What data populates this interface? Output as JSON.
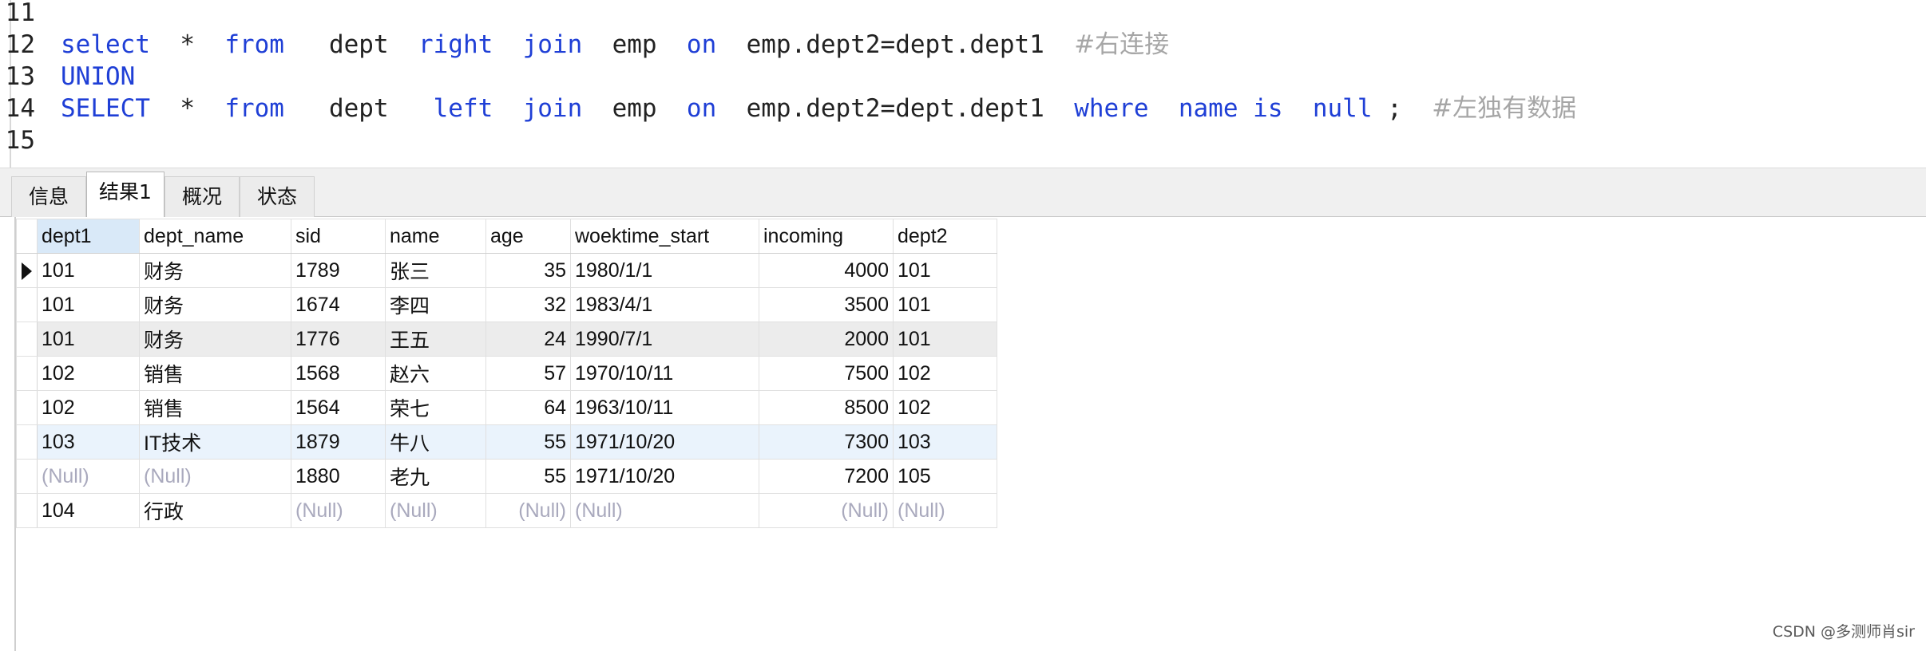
{
  "editor": {
    "lines": [
      {
        "num": "11",
        "tokens": []
      },
      {
        "num": "12",
        "tokens": [
          {
            "t": "select",
            "c": "kw",
            "gap": "  "
          },
          {
            "t": "*",
            "c": "tx",
            "gap": "  "
          },
          {
            "t": "from",
            "c": "kw",
            "gap": "   "
          },
          {
            "t": "dept",
            "c": "tx",
            "gap": "  "
          },
          {
            "t": "right",
            "c": "kw",
            "gap": "  "
          },
          {
            "t": "join",
            "c": "kw",
            "gap": "  "
          },
          {
            "t": "emp",
            "c": "tx",
            "gap": "  "
          },
          {
            "t": "on",
            "c": "kw",
            "gap": "  "
          },
          {
            "t": "emp.dept2=dept.dept1",
            "c": "tx",
            "gap": "  "
          },
          {
            "t": "#右连接",
            "c": "cm",
            "gap": ""
          }
        ]
      },
      {
        "num": "13",
        "tokens": [
          {
            "t": "UNION",
            "c": "kw",
            "gap": ""
          }
        ]
      },
      {
        "num": "14",
        "tokens": [
          {
            "t": "SELECT",
            "c": "kw",
            "gap": "  "
          },
          {
            "t": "*",
            "c": "tx",
            "gap": "  "
          },
          {
            "t": "from",
            "c": "kw",
            "gap": "   "
          },
          {
            "t": "dept",
            "c": "tx",
            "gap": "   "
          },
          {
            "t": "left",
            "c": "kw",
            "gap": "  "
          },
          {
            "t": "join",
            "c": "kw",
            "gap": "  "
          },
          {
            "t": "emp",
            "c": "tx",
            "gap": "  "
          },
          {
            "t": "on",
            "c": "kw",
            "gap": "  "
          },
          {
            "t": "emp.dept2=dept.dept1",
            "c": "tx",
            "gap": "  "
          },
          {
            "t": "where",
            "c": "kw",
            "gap": "  "
          },
          {
            "t": "name",
            "c": "kw",
            "gap": " "
          },
          {
            "t": "is",
            "c": "kw",
            "gap": "  "
          },
          {
            "t": "null",
            "c": "kw",
            "gap": " "
          },
          {
            "t": ";",
            "c": "tx",
            "gap": "  "
          },
          {
            "t": "#左独有数据",
            "c": "cm",
            "gap": ""
          }
        ]
      },
      {
        "num": "15",
        "tokens": []
      }
    ]
  },
  "tabs": [
    {
      "label": "信息",
      "active": false
    },
    {
      "label": "结果1",
      "active": true
    },
    {
      "label": "概况",
      "active": false
    },
    {
      "label": "状态",
      "active": false
    }
  ],
  "result": {
    "columns": [
      "dept1",
      "dept_name",
      "sid",
      "name",
      "age",
      "woektime_start",
      "incoming",
      "dept2"
    ],
    "rows": [
      [
        "101",
        "财务",
        "1789",
        "张三",
        "35",
        "1980/1/1",
        "4000",
        "101"
      ],
      [
        "101",
        "财务",
        "1674",
        "李四",
        "32",
        "1983/4/1",
        "3500",
        "101"
      ],
      [
        "101",
        "财务",
        "1776",
        "王五",
        "24",
        "1990/7/1",
        "2000",
        "101"
      ],
      [
        "102",
        "销售",
        "1568",
        "赵六",
        "57",
        "1970/10/11",
        "7500",
        "102"
      ],
      [
        "102",
        "销售",
        "1564",
        "荣七",
        "64",
        "1963/10/11",
        "8500",
        "102"
      ],
      [
        "103",
        "IT技术",
        "1879",
        "牛八",
        "55",
        "1971/10/20",
        "7300",
        "103"
      ],
      [
        "(Null)",
        "(Null)",
        "1880",
        "老九",
        "55",
        "1971/10/20",
        "7200",
        "105"
      ],
      [
        "104",
        "行政",
        "(Null)",
        "(Null)",
        "(Null)",
        "(Null)",
        "(Null)",
        "(Null)"
      ]
    ],
    "current_row": 0,
    "highlight_row": 2,
    "selected_row": 5
  },
  "watermark": "CSDN @多测师肖sir",
  "colors": {
    "keyword": "#1f3fd6",
    "comment": "#a6a6a6",
    "null_text": "#a9a9bd",
    "selected_header": "#d9e9f8"
  }
}
